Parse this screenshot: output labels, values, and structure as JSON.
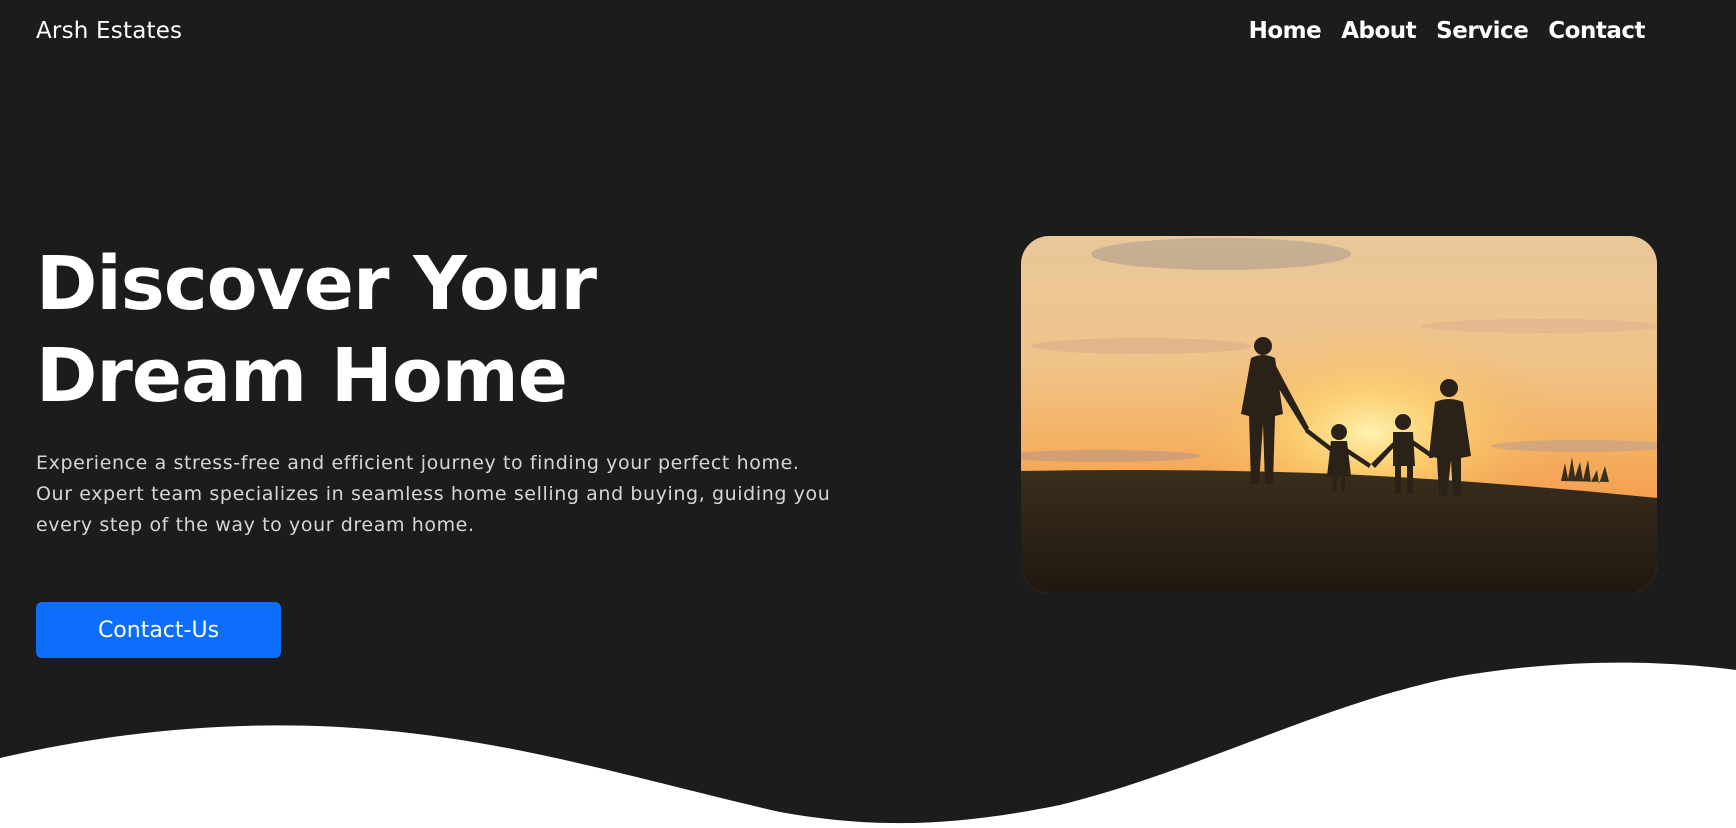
{
  "header": {
    "brand": "Arsh Estates",
    "nav": [
      {
        "label": "Home"
      },
      {
        "label": "About"
      },
      {
        "label": "Service"
      },
      {
        "label": "Contact"
      }
    ]
  },
  "hero": {
    "title": "Discover Your Dream Home",
    "description": "Experience a stress-free and efficient journey to finding your perfect home. Our expert team specializes in seamless home selling and buying, guiding you every step of the way to your dream home.",
    "cta_label": "Contact-Us",
    "image": "family-sunset-photo"
  },
  "colors": {
    "background": "#1c1c1c",
    "accent": "#0d6efd",
    "wave": "#ffffff"
  }
}
